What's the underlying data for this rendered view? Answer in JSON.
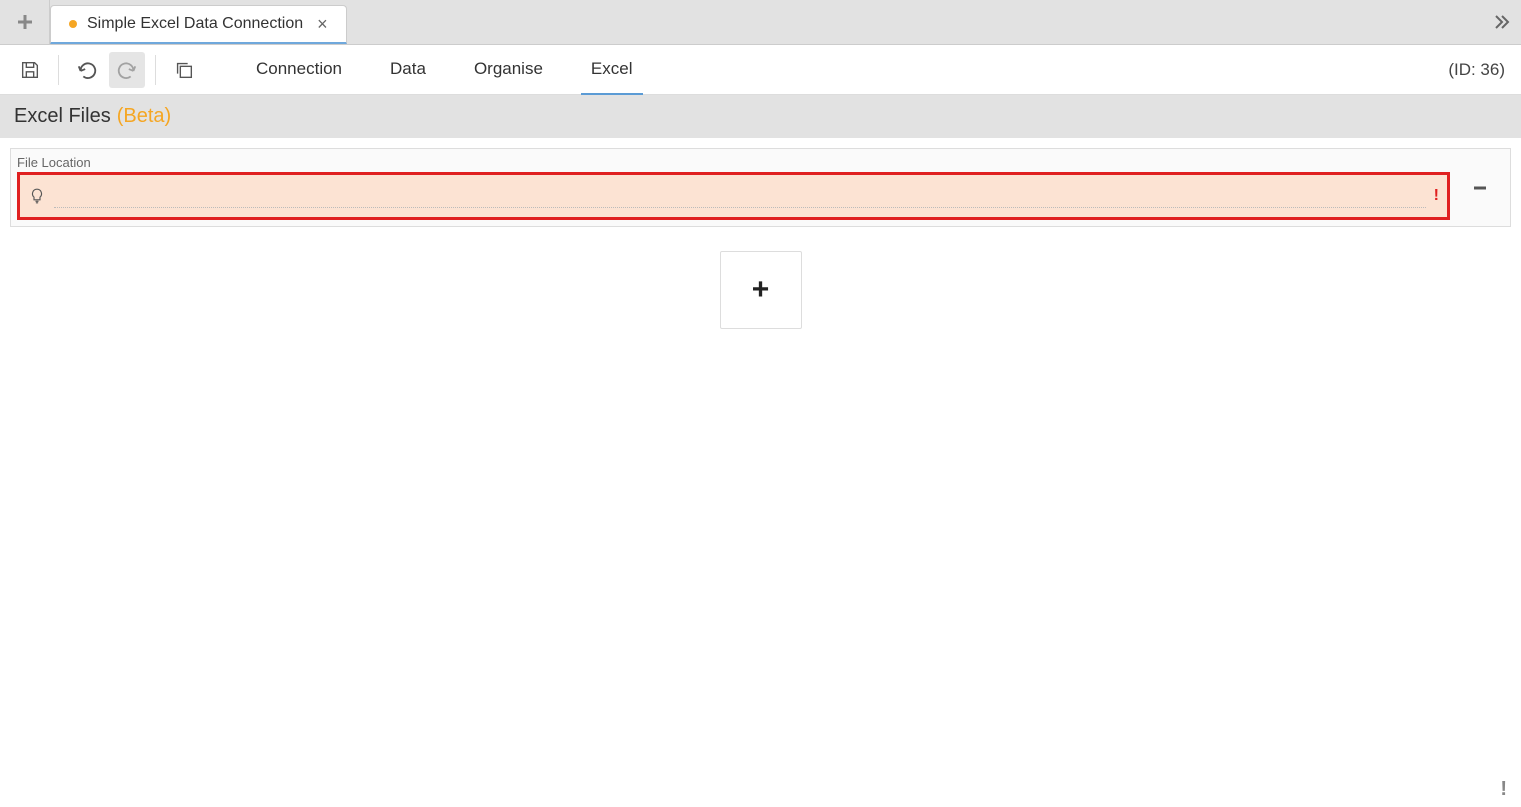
{
  "tabs": {
    "active": {
      "title": "Simple Excel Data Connection",
      "dirty": true
    }
  },
  "toolbar": {
    "id_label": "(ID: 36)"
  },
  "nav": {
    "items": [
      {
        "label": "Connection",
        "active": false
      },
      {
        "label": "Data",
        "active": false
      },
      {
        "label": "Organise",
        "active": false
      },
      {
        "label": "Excel",
        "active": true
      }
    ]
  },
  "section": {
    "title": "Excel Files",
    "beta_label": "(Beta)"
  },
  "file_row": {
    "label": "File Location",
    "value": "",
    "placeholder": "",
    "error": true,
    "warn_glyph": "!"
  },
  "icons": {
    "plus": "+",
    "status_warn": "!"
  }
}
